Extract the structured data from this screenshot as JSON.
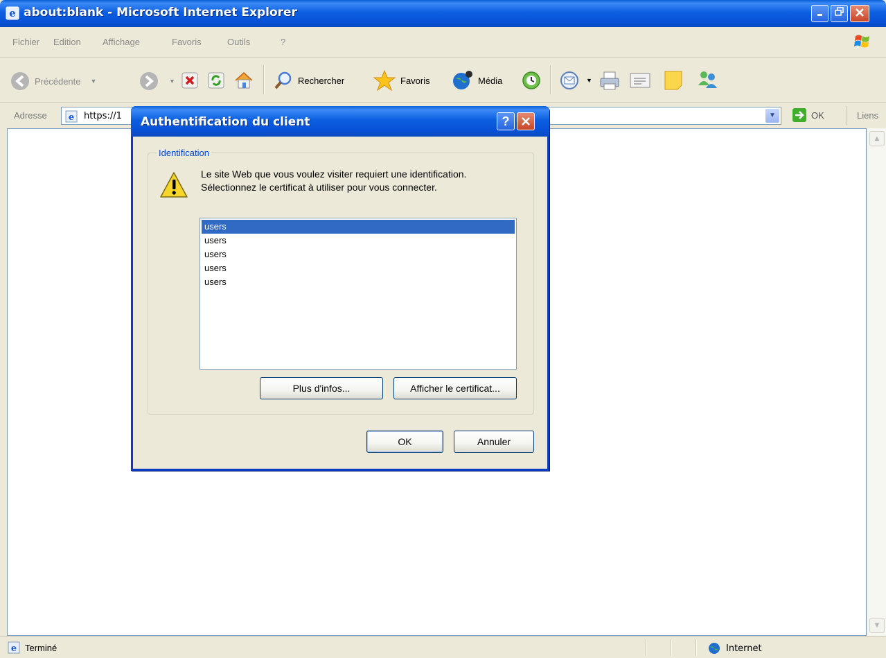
{
  "window": {
    "title": "about:blank - Microsoft Internet Explorer",
    "minimize_icon": "minimize-icon",
    "restore_icon": "restore-icon",
    "close_icon": "close-icon"
  },
  "menubar": {
    "items": [
      "Fichier",
      "Edition",
      "Affichage",
      "Favoris",
      "Outils",
      "?"
    ]
  },
  "toolbar": {
    "back_label": "Précédente",
    "search_label": "Rechercher",
    "favorites_label": "Favoris",
    "media_label": "Média"
  },
  "addressbar": {
    "label": "Adresse",
    "value": "https://1",
    "go_label": "OK",
    "links_label": "Liens"
  },
  "statusbar": {
    "text": "Terminé",
    "zone": "Internet"
  },
  "dialog": {
    "title": "Authentification du client",
    "group_label": "Identification",
    "message_line1": "Le site Web que vous voulez visiter requiert une identification.",
    "message_line2": "Sélectionnez le certificat à utiliser pour vous connecter.",
    "certificates": [
      "users",
      "users",
      "users",
      "users",
      "users"
    ],
    "selected_index": 0,
    "more_info_label": "Plus d'infos...",
    "view_cert_label": "Afficher le certificat...",
    "ok_label": "OK",
    "cancel_label": "Annuler"
  },
  "colors": {
    "titlebar_blue": "#0c5fe0",
    "selection": "#316ac5",
    "group_label": "#0046d5"
  }
}
